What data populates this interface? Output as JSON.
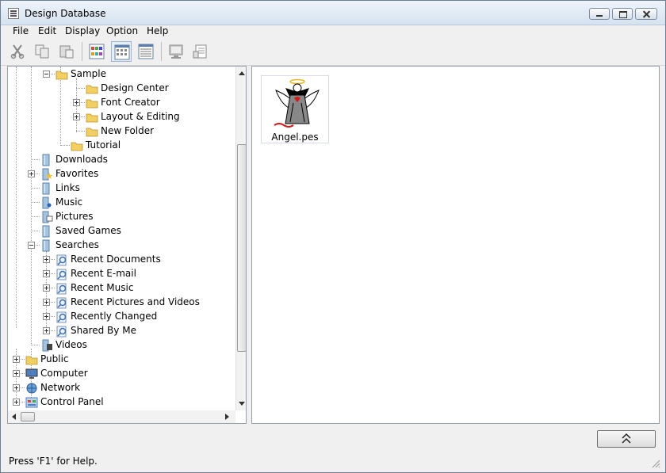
{
  "window": {
    "title": "Design Database"
  },
  "menu": [
    "File",
    "Edit",
    "Display",
    "Option",
    "Help"
  ],
  "toolbar": {
    "buttons": [
      "cut-icon",
      "copy-icon",
      "paste-icon",
      "large-thumbnails-icon",
      "small-thumbnails-icon",
      "details-view-icon",
      "preview-icon",
      "properties-icon"
    ]
  },
  "tree": {
    "items": [
      {
        "label": "Sample",
        "icon": "folder-open-icon",
        "expander": "minus"
      },
      {
        "label": "Design Center",
        "icon": "folder-icon",
        "expander": ""
      },
      {
        "label": "Font Creator",
        "icon": "folder-icon",
        "expander": "plus"
      },
      {
        "label": "Layout & Editing",
        "icon": "folder-icon",
        "expander": "plus"
      },
      {
        "label": "New Folder",
        "icon": "folder-icon",
        "expander": ""
      },
      {
        "label": "Tutorial",
        "icon": "folder-icon",
        "expander": ""
      },
      {
        "label": "Downloads",
        "icon": "downloads-icon",
        "expander": ""
      },
      {
        "label": "Favorites",
        "icon": "favorites-icon",
        "expander": "plus"
      },
      {
        "label": "Links",
        "icon": "links-icon",
        "expander": ""
      },
      {
        "label": "Music",
        "icon": "music-icon",
        "expander": ""
      },
      {
        "label": "Pictures",
        "icon": "pictures-icon",
        "expander": ""
      },
      {
        "label": "Saved Games",
        "icon": "saved-games-icon",
        "expander": ""
      },
      {
        "label": "Searches",
        "icon": "searches-icon",
        "expander": "minus"
      },
      {
        "label": "Recent Documents",
        "icon": "saved-search-icon",
        "expander": "plus"
      },
      {
        "label": "Recent E-mail",
        "icon": "saved-search-icon",
        "expander": "plus"
      },
      {
        "label": "Recent Music",
        "icon": "saved-search-icon",
        "expander": "plus"
      },
      {
        "label": "Recent Pictures and Videos",
        "icon": "saved-search-icon",
        "expander": "plus"
      },
      {
        "label": "Recently Changed",
        "icon": "saved-search-icon",
        "expander": "plus"
      },
      {
        "label": "Shared By Me",
        "icon": "saved-search-icon",
        "expander": "plus"
      },
      {
        "label": "Videos",
        "icon": "videos-icon",
        "expander": ""
      },
      {
        "label": "Public",
        "icon": "folder-icon",
        "expander": "plus"
      },
      {
        "label": "Computer",
        "icon": "computer-icon",
        "expander": "plus"
      },
      {
        "label": "Network",
        "icon": "network-icon",
        "expander": "plus"
      },
      {
        "label": "Control Panel",
        "icon": "control-panel-icon",
        "expander": "plus"
      }
    ]
  },
  "content": {
    "files": [
      {
        "name": "Angel.pes",
        "icon": "angel-embroidery-icon"
      }
    ]
  },
  "panel": {
    "collapse_icon": "double-chevron-up-icon"
  },
  "status": {
    "text": "Press 'F1' for Help."
  },
  "colors": {
    "folder": "#f2cf62",
    "selection_border": "#9fb4cf",
    "window_bg": "#f0f0f0"
  }
}
